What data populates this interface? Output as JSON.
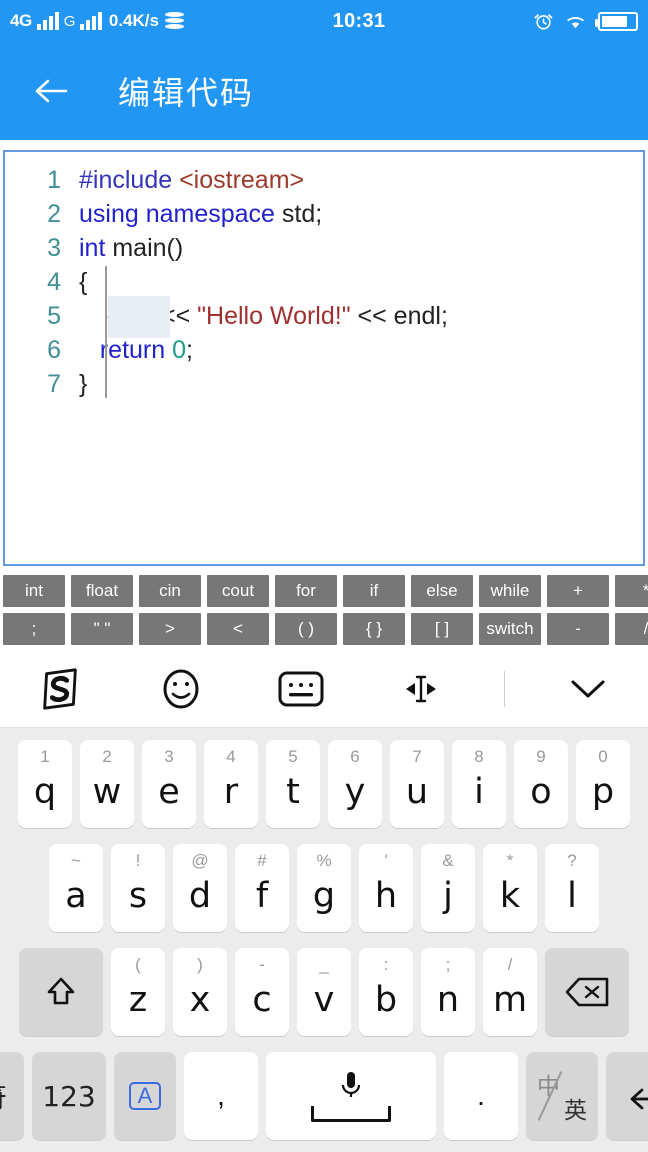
{
  "status_bar": {
    "network_primary": "4G",
    "network_secondary": "G",
    "speed": "0.4K/s",
    "time": "10:31",
    "icons": [
      "signal-bars-icon",
      "signal-bars-icon",
      "data-stack-icon",
      "alarm-icon",
      "wifi-icon",
      "battery-icon"
    ],
    "battery_level_percent": 78
  },
  "app_bar": {
    "back_label": "←",
    "title": "编辑代码",
    "background_color": "#2196f3"
  },
  "editor": {
    "language": "cpp",
    "border_color": "#6699dd",
    "line_number_color": "#3f8f96",
    "lines": [
      {
        "n": "1",
        "tokens": [
          {
            "t": "#include ",
            "c": "pre"
          },
          {
            "t": "<iostream>",
            "c": "inc"
          }
        ]
      },
      {
        "n": "2",
        "tokens": [
          {
            "t": "using namespace ",
            "c": "kw"
          },
          {
            "t": "std;",
            "c": "plain"
          }
        ]
      },
      {
        "n": "3",
        "tokens": [
          {
            "t": "int ",
            "c": "kw"
          },
          {
            "t": "main()",
            "c": "plain"
          }
        ]
      },
      {
        "n": "4",
        "tokens": [
          {
            "t": "{",
            "c": "plain"
          }
        ]
      },
      {
        "n": "5",
        "tokens": [
          {
            "t": "    cout << ",
            "c": "plain"
          },
          {
            "t": "\"Hello World!\"",
            "c": "str"
          },
          {
            "t": " << endl;",
            "c": "plain"
          }
        ]
      },
      {
        "n": "6",
        "tokens": [
          {
            "t": "   ",
            "c": "plain"
          },
          {
            "t": "return ",
            "c": "kw"
          },
          {
            "t": "0",
            "c": "num"
          },
          {
            "t": ";",
            "c": "plain"
          }
        ]
      },
      {
        "n": "7",
        "tokens": [
          {
            "t": "}",
            "c": "plain"
          }
        ]
      }
    ]
  },
  "shortcut_keys": {
    "row1": [
      "int",
      "float",
      "cin",
      "cout",
      "for",
      "if",
      "else",
      "while",
      "+",
      "*"
    ],
    "row2": [
      ";",
      "\" \"",
      ">",
      "<",
      "( )",
      "{ }",
      "[ ]",
      "switch",
      "-",
      "/"
    ],
    "background_color": "#777777"
  },
  "keyboard": {
    "toolbar": [
      "sogou-logo-icon",
      "emoji-icon",
      "keyboard-switch-icon",
      "cursor-move-icon",
      "divider",
      "collapse-keyboard-icon"
    ],
    "row1": [
      {
        "main": "q",
        "sup": "1"
      },
      {
        "main": "w",
        "sup": "2"
      },
      {
        "main": "e",
        "sup": "3"
      },
      {
        "main": "r",
        "sup": "4"
      },
      {
        "main": "t",
        "sup": "5"
      },
      {
        "main": "y",
        "sup": "6"
      },
      {
        "main": "u",
        "sup": "7"
      },
      {
        "main": "i",
        "sup": "8"
      },
      {
        "main": "o",
        "sup": "9"
      },
      {
        "main": "p",
        "sup": "0"
      }
    ],
    "row2": [
      {
        "main": "a",
        "sup": "~"
      },
      {
        "main": "s",
        "sup": "!"
      },
      {
        "main": "d",
        "sup": "@"
      },
      {
        "main": "f",
        "sup": "#"
      },
      {
        "main": "g",
        "sup": "%"
      },
      {
        "main": "h",
        "sup": "'"
      },
      {
        "main": "j",
        "sup": "&"
      },
      {
        "main": "k",
        "sup": "*"
      },
      {
        "main": "l",
        "sup": "?"
      }
    ],
    "row3": [
      {
        "main": "z",
        "sup": "("
      },
      {
        "main": "x",
        "sup": ")"
      },
      {
        "main": "c",
        "sup": "-"
      },
      {
        "main": "v",
        "sup": "_"
      },
      {
        "main": "b",
        "sup": ":"
      },
      {
        "main": "n",
        "sup": ";"
      },
      {
        "main": "m",
        "sup": "/"
      }
    ],
    "shift_label": "shift-icon",
    "backspace_label": "backspace-icon",
    "row4": {
      "symbol": "符",
      "numbers": "123",
      "caps": "A",
      "comma": ",",
      "space": "space-mic-icon",
      "period": ".",
      "cn": "中",
      "en": "英",
      "enter": "enter-icon"
    },
    "background_color": "#ececec",
    "key_color": "#ffffff",
    "func_key_color": "#d6d6d6"
  }
}
